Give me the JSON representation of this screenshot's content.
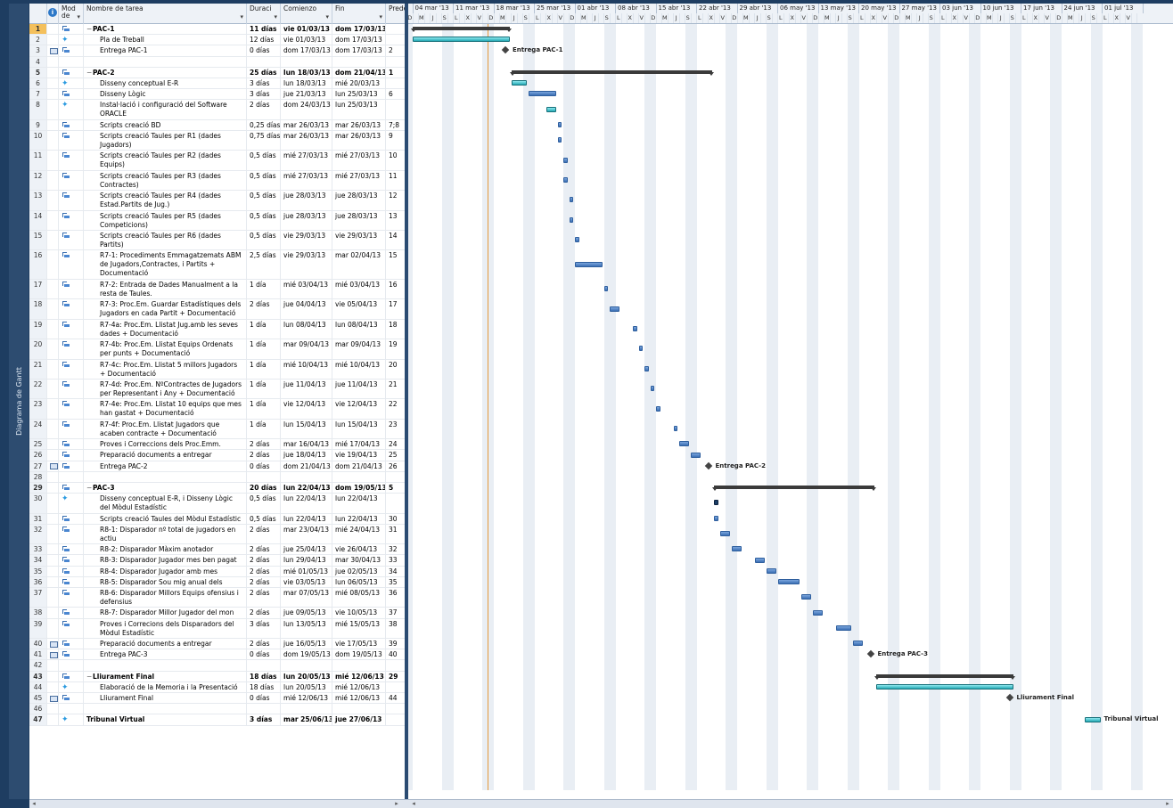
{
  "sidebar": {
    "label": "Diagrama de Gantt"
  },
  "columns": {
    "mode": "Mod de",
    "name": "Nombre de tarea",
    "duration": "Duraci",
    "start": "Comienzo",
    "finish": "Fin",
    "pred": "Prede"
  },
  "weeks": [
    "'13",
    "04 mar '13",
    "11 mar '13",
    "18 mar '13",
    "25 mar '13",
    "01 abr '13",
    "08 abr '13",
    "15 abr '13",
    "22 abr '13",
    "29 abr '13",
    "06 may '13",
    "13 may '13",
    "20 may '13",
    "27 may '13",
    "03 jun '13",
    "10 jun '13",
    "17 jun '13",
    "24 jun '13",
    "01 jul '13"
  ],
  "day_letters": [
    "J",
    "S",
    "L",
    "X",
    "V",
    "D",
    "M",
    "J",
    "S"
  ],
  "rows": [
    {
      "n": "1",
      "t": "summary",
      "name": "PAC-1",
      "dur": "11 días",
      "start": "vie 01/03/13",
      "fin": "dom 17/03/13",
      "pred": "",
      "mode": "task",
      "sel": true
    },
    {
      "n": "2",
      "name": "Pla de Treball",
      "dur": "12 días",
      "start": "vie 01/03/13",
      "fin": "dom 17/03/13",
      "pred": "",
      "mode": "pin"
    },
    {
      "n": "3",
      "name": "Entrega PAC-1",
      "dur": "0 días",
      "start": "dom 17/03/13",
      "fin": "dom 17/03/13",
      "pred": "2",
      "mode": "task",
      "ind": "cal"
    },
    {
      "n": "4",
      "name": "",
      "dur": "",
      "start": "",
      "fin": "",
      "pred": ""
    },
    {
      "n": "5",
      "t": "summary",
      "name": "PAC-2",
      "dur": "25 días",
      "start": "lun 18/03/13",
      "fin": "dom 21/04/13",
      "pred": "1",
      "mode": "task"
    },
    {
      "n": "6",
      "name": "Disseny conceptual E-R",
      "dur": "3 días",
      "start": "lun 18/03/13",
      "fin": "mié 20/03/13",
      "pred": "",
      "mode": "pin"
    },
    {
      "n": "7",
      "name": "Disseny Lògic",
      "dur": "3 días",
      "start": "jue 21/03/13",
      "fin": "lun 25/03/13",
      "pred": "6",
      "mode": "task"
    },
    {
      "n": "8",
      "name": "Instal·lació i configuració del Software ORACLE",
      "dur": "2 días",
      "start": "dom 24/03/13",
      "fin": "lun 25/03/13",
      "pred": "",
      "mode": "pin",
      "h": 2
    },
    {
      "n": "9",
      "name": "Scripts creació BD",
      "dur": "0,25 días",
      "start": "mar 26/03/13",
      "fin": "mar 26/03/13",
      "pred": "7;8",
      "mode": "task"
    },
    {
      "n": "10",
      "name": "Scripts creació Taules per R1 (dades Jugadors)",
      "dur": "0,75 días",
      "start": "mar 26/03/13",
      "fin": "mar 26/03/13",
      "pred": "9",
      "mode": "task",
      "h": 2
    },
    {
      "n": "11",
      "name": "Scripts creació Taules per R2 (dades Equips)",
      "dur": "0,5 días",
      "start": "mié 27/03/13",
      "fin": "mié 27/03/13",
      "pred": "10",
      "mode": "task",
      "h": 2
    },
    {
      "n": "12",
      "name": "Scripts creació Taules per R3 (dades Contractes)",
      "dur": "0,5 días",
      "start": "mié 27/03/13",
      "fin": "mié 27/03/13",
      "pred": "11",
      "mode": "task",
      "h": 2
    },
    {
      "n": "13",
      "name": "Scripts creació Taules per R4 (dades Estad.Partits de Jug.)",
      "dur": "0,5 días",
      "start": "jue 28/03/13",
      "fin": "jue 28/03/13",
      "pred": "12",
      "mode": "task",
      "h": 2
    },
    {
      "n": "14",
      "name": "Scripts creació Taules per R5 (dades Competicions)",
      "dur": "0,5 días",
      "start": "jue 28/03/13",
      "fin": "jue 28/03/13",
      "pred": "13",
      "mode": "task",
      "h": 2
    },
    {
      "n": "15",
      "name": "Scripts creació Taules per R6 (dades Partits)",
      "dur": "0,5 días",
      "start": "vie 29/03/13",
      "fin": "vie 29/03/13",
      "pred": "14",
      "mode": "task",
      "h": 2
    },
    {
      "n": "16",
      "name": "R7-1: Procediments Emmagatzemats ABM de Jugadors,Contractes, i Partits + Documentació",
      "dur": "2,5 días",
      "start": "vie 29/03/13",
      "fin": "mar 02/04/13",
      "pred": "15",
      "mode": "task",
      "h": 3
    },
    {
      "n": "17",
      "name": "R7-2: Entrada de Dades Manualment a la resta de Taules.",
      "dur": "1 día",
      "start": "mié 03/04/13",
      "fin": "mié 03/04/13",
      "pred": "16",
      "mode": "task",
      "h": 2
    },
    {
      "n": "18",
      "name": "R7-3: Proc.Em. Guardar Estadístiques dels Jugadors en cada Partit + Documentació",
      "dur": "2 días",
      "start": "jue 04/04/13",
      "fin": "vie 05/04/13",
      "pred": "17",
      "mode": "task",
      "h": 2
    },
    {
      "n": "19",
      "name": "R7-4a: Proc.Em. Llistat Jug.amb les seves dades + Documentació",
      "dur": "1 día",
      "start": "lun 08/04/13",
      "fin": "lun 08/04/13",
      "pred": "18",
      "mode": "task",
      "h": 2
    },
    {
      "n": "20",
      "name": "R7-4b: Proc.Em. Llistat Equips Ordenats per punts + Documentació",
      "dur": "1 día",
      "start": "mar 09/04/13",
      "fin": "mar 09/04/13",
      "pred": "19",
      "mode": "task",
      "h": 2
    },
    {
      "n": "21",
      "name": "R7-4c: Proc.Em. Llistat 5 millors Jugadors + Documentació",
      "dur": "1 día",
      "start": "mié 10/04/13",
      "fin": "mié 10/04/13",
      "pred": "20",
      "mode": "task",
      "h": 2
    },
    {
      "n": "22",
      "name": "R7-4d: Proc.Em. NºContractes de Jugadors per Representant i Any + Documentació",
      "dur": "1 día",
      "start": "jue 11/04/13",
      "fin": "jue 11/04/13",
      "pred": "21",
      "mode": "task",
      "h": 2
    },
    {
      "n": "23",
      "name": "R7-4e: Proc.Em. Llistat 10 equips que mes han gastat + Documentació",
      "dur": "1 día",
      "start": "vie 12/04/13",
      "fin": "vie 12/04/13",
      "pred": "22",
      "mode": "task",
      "h": 2
    },
    {
      "n": "24",
      "name": "R7-4f: Proc.Em. Llistat Jugadors que acaben contracte + Documentació",
      "dur": "1 día",
      "start": "lun 15/04/13",
      "fin": "lun 15/04/13",
      "pred": "23",
      "mode": "task",
      "h": 2
    },
    {
      "n": "25",
      "name": "Proves i Correccions dels Proc.Emm.",
      "dur": "2 días",
      "start": "mar 16/04/13",
      "fin": "mié 17/04/13",
      "pred": "24",
      "mode": "task"
    },
    {
      "n": "26",
      "name": "Preparació documents a entregar",
      "dur": "2 días",
      "start": "jue 18/04/13",
      "fin": "vie 19/04/13",
      "pred": "25",
      "mode": "task"
    },
    {
      "n": "27",
      "name": "Entrega PAC-2",
      "dur": "0 días",
      "start": "dom 21/04/13",
      "fin": "dom 21/04/13",
      "pred": "26",
      "mode": "task",
      "ind": "cal"
    },
    {
      "n": "28",
      "name": "",
      "dur": "",
      "start": "",
      "fin": "",
      "pred": ""
    },
    {
      "n": "29",
      "t": "summary",
      "name": "PAC-3",
      "dur": "20 días",
      "start": "lun 22/04/13",
      "fin": "dom 19/05/13",
      "pred": "5",
      "mode": "task"
    },
    {
      "n": "30",
      "name": "Disseny conceptual E-R, i Disseny Lògic del Mòdul Estadístic",
      "dur": "0,5 días",
      "start": "lun 22/04/13",
      "fin": "lun 22/04/13",
      "pred": "",
      "mode": "pin",
      "h": 2
    },
    {
      "n": "31",
      "name": "Scripts creació Taules del Mòdul Estadístic",
      "dur": "0,5 días",
      "start": "lun 22/04/13",
      "fin": "lun 22/04/13",
      "pred": "30",
      "mode": "task"
    },
    {
      "n": "32",
      "name": "R8-1: Disparador nº total de jugadors en actiu",
      "dur": "2 días",
      "start": "mar 23/04/13",
      "fin": "mié 24/04/13",
      "pred": "31",
      "mode": "task",
      "h": 2
    },
    {
      "n": "33",
      "name": "R8-2: Disparador Màxim anotador",
      "dur": "2 días",
      "start": "jue 25/04/13",
      "fin": "vie 26/04/13",
      "pred": "32",
      "mode": "task"
    },
    {
      "n": "34",
      "name": "R8-3: Disparador Jugador mes ben pagat",
      "dur": "2 días",
      "start": "lun 29/04/13",
      "fin": "mar 30/04/13",
      "pred": "33",
      "mode": "task"
    },
    {
      "n": "35",
      "name": "R8-4: Disparador Jugador amb mes guanys",
      "dur": "2 días",
      "start": "mié 01/05/13",
      "fin": "jue 02/05/13",
      "pred": "34",
      "mode": "task"
    },
    {
      "n": "36",
      "name": "R8-5: Disparador Sou mig anual dels Jugad.",
      "dur": "2 días",
      "start": "vie 03/05/13",
      "fin": "lun 06/05/13",
      "pred": "35",
      "mode": "task"
    },
    {
      "n": "37",
      "name": "R8-6: Disparador Millors Equips ofensius i defensius",
      "dur": "2 días",
      "start": "mar 07/05/13",
      "fin": "mié 08/05/13",
      "pred": "36",
      "mode": "task",
      "h": 2
    },
    {
      "n": "38",
      "name": "R8-7: Disparador Millor Jugador del mon",
      "dur": "2 días",
      "start": "jue 09/05/13",
      "fin": "vie 10/05/13",
      "pred": "37",
      "mode": "task"
    },
    {
      "n": "39",
      "name": "Proves i Correcions dels Disparadors del Mòdul Estadístic",
      "dur": "3 días",
      "start": "lun 13/05/13",
      "fin": "mié 15/05/13",
      "pred": "38",
      "mode": "task",
      "h": 2
    },
    {
      "n": "40",
      "name": "Preparació documents a entregar",
      "dur": "2 días",
      "start": "jue 16/05/13",
      "fin": "vie 17/05/13",
      "pred": "39",
      "mode": "task",
      "ind": "cal"
    },
    {
      "n": "41",
      "name": "Entrega PAC-3",
      "dur": "0 días",
      "start": "dom 19/05/13",
      "fin": "dom 19/05/13",
      "pred": "40",
      "mode": "task",
      "ind": "cal"
    },
    {
      "n": "42",
      "name": "",
      "dur": "",
      "start": "",
      "fin": "",
      "pred": ""
    },
    {
      "n": "43",
      "t": "summary",
      "name": "Lliurament Final",
      "dur": "18 días",
      "start": "lun 20/05/13",
      "fin": "mié 12/06/13",
      "pred": "29",
      "mode": "task"
    },
    {
      "n": "44",
      "name": "Elaboració de la Memoria i la Presentació",
      "dur": "18 días",
      "start": "lun 20/05/13",
      "fin": "mié 12/06/13",
      "pred": "",
      "mode": "pin"
    },
    {
      "n": "45",
      "name": "Lliurament Final",
      "dur": "0 días",
      "start": "mié 12/06/13",
      "fin": "mié 12/06/13",
      "pred": "44",
      "mode": "task",
      "ind": "cal"
    },
    {
      "n": "46",
      "name": "",
      "dur": "",
      "start": "",
      "fin": "",
      "pred": ""
    },
    {
      "n": "47",
      "t": "summary",
      "name": "Tribunal Virtual",
      "dur": "3 días",
      "start": "mar 25/06/13",
      "fin": "jue 27/06/13",
      "pred": "",
      "mode": "pin",
      "nofold": true
    }
  ],
  "milestone_labels": {
    "pac1": "Entrega PAC-1",
    "pac2": "Entrega PAC-2",
    "pac3": "Entrega PAC-3",
    "final": "Lliurament Final",
    "tribunal": "Tribunal Virtual"
  },
  "colors": {
    "auto_task": "#4a7fc4",
    "manual_task": "#2ab3bd",
    "summary": "#3a3a3a",
    "today_line": "#e59a3c"
  }
}
